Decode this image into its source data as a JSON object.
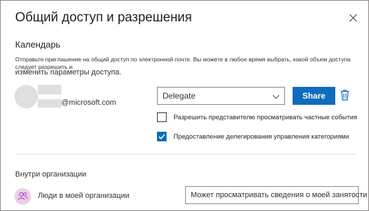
{
  "dialog": {
    "title": "Общий доступ и разрешения",
    "close_icon": "close-icon"
  },
  "calendar": {
    "section_title": "Календарь",
    "description_line1": "Отправьте приглашение на общий доступ по электронной почте. Вы можете в любое время выбрать, какой объем доступа следует разрешить и",
    "description_line2": "изменить параметры доступа."
  },
  "person": {
    "email_domain": "@microsoft.com",
    "permission": "Delegate",
    "share_label": "Share",
    "delete_icon": "trash-icon"
  },
  "options": [
    {
      "label": "Разрешить представителю просматривать частные события",
      "checked": false
    },
    {
      "label": "Предоставление делегирования управления категориями",
      "checked": true
    }
  ],
  "organization": {
    "section_title": "Внутри организации",
    "name": "Люди в моей организации",
    "permission": "Может просматривать сведения о моей занятости"
  },
  "colors": {
    "accent": "#0f6cbd",
    "avatar_placeholder": "#e1dfdd",
    "org_avatar": "#e8d1e6",
    "org_avatar_icon": "#b146c2"
  }
}
